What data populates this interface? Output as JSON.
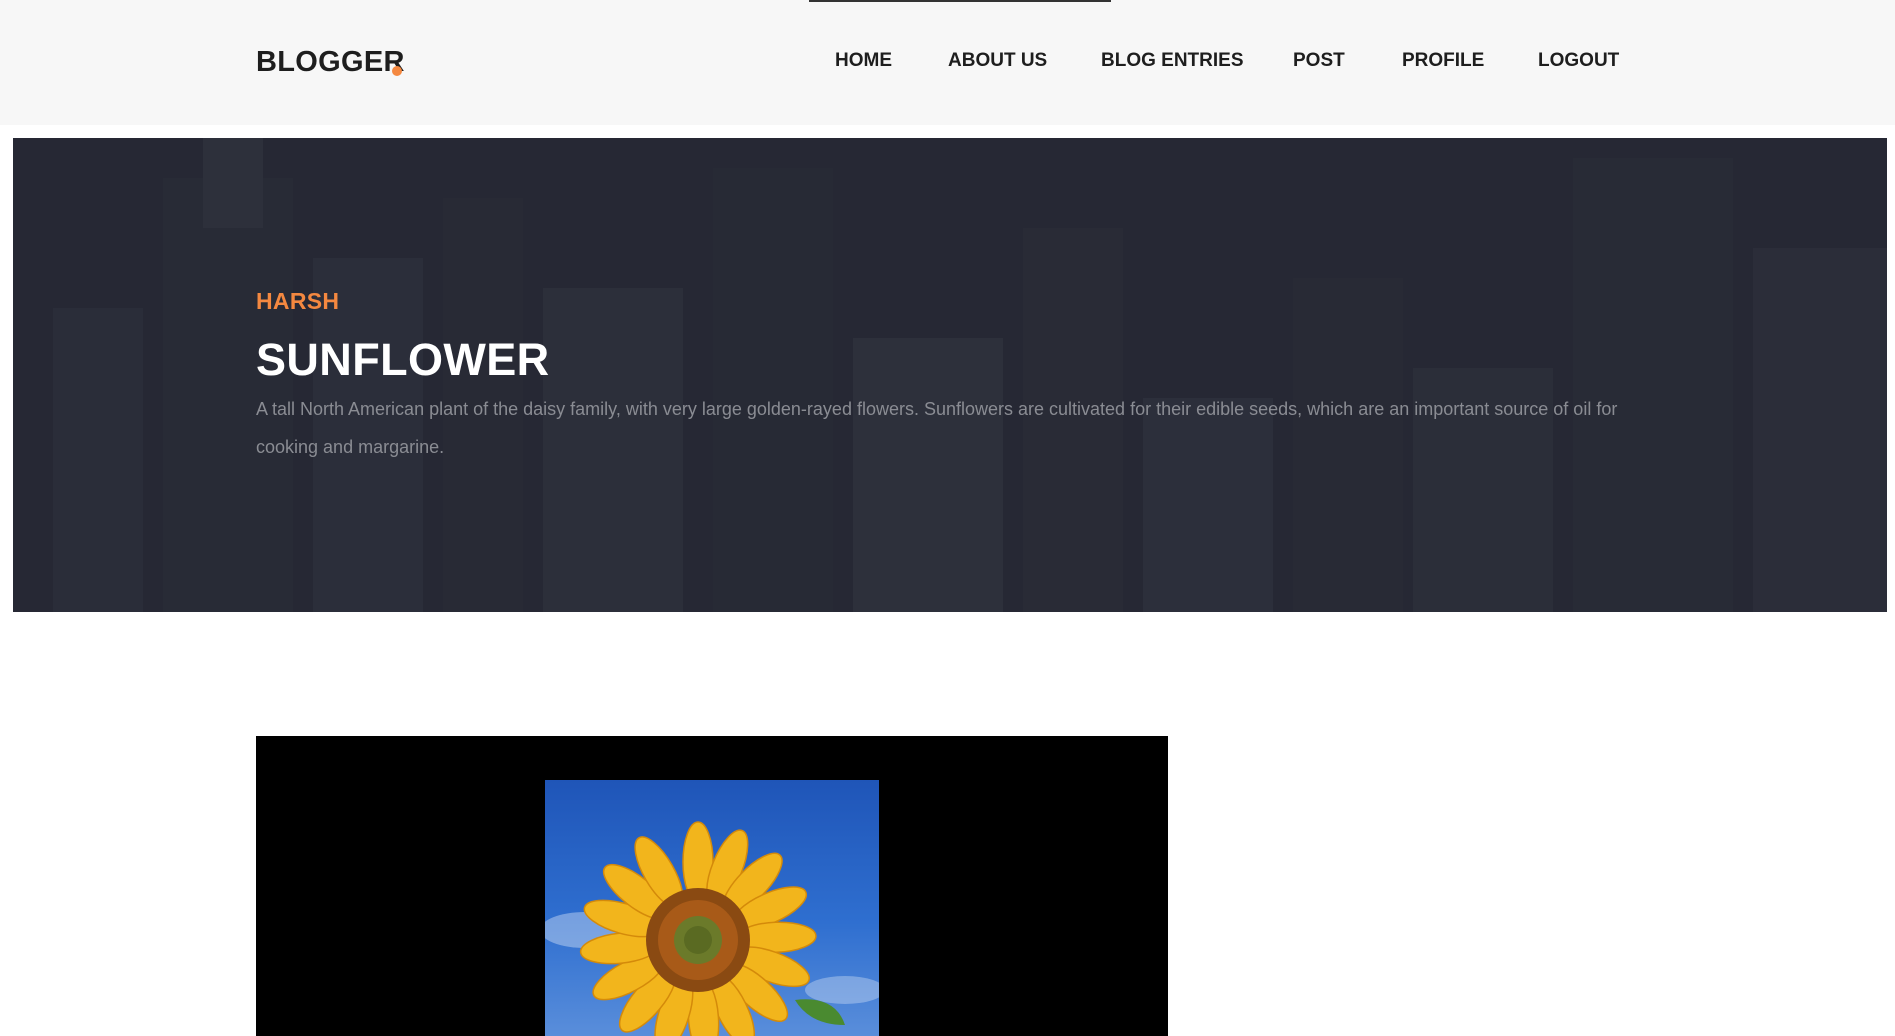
{
  "header": {
    "brand": "BLOGGER",
    "accent_color": "#f48840",
    "nav": [
      {
        "label": "HOME"
      },
      {
        "label": "ABOUT US"
      },
      {
        "label": "BLOG ENTRIES"
      },
      {
        "label": "POST"
      },
      {
        "label": "PROFILE"
      },
      {
        "label": "LOGOUT"
      }
    ]
  },
  "hero": {
    "author": "HARSH",
    "title": "SUNFLOWER",
    "description": "A tall North American plant of the daisy family, with very large golden-rayed flowers. Sunflowers are cultivated for their edible seeds, which are an important source of oil for cooking and margarine."
  },
  "post": {
    "image": "sunflower photo"
  }
}
